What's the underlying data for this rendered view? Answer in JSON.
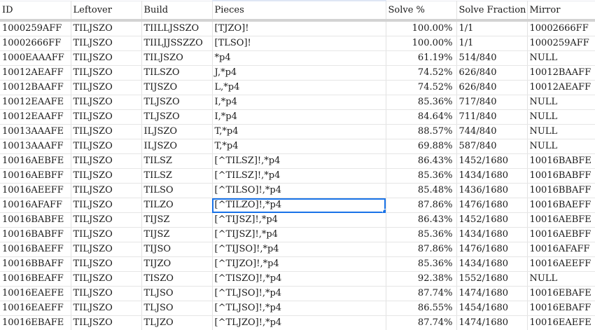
{
  "columns": [
    "ID",
    "Leftover",
    "Build",
    "Pieces",
    "Solve %",
    "Solve Fraction",
    "Mirror"
  ],
  "rows": [
    [
      "1000259AFF",
      "TILJSZO",
      "TIILLJSSZO",
      "[TJZO]!",
      "100.00%",
      "1/1",
      "10002666FF"
    ],
    [
      "10002666FF",
      "TILJSZO",
      "TIILJJSSZZO",
      "[TLSO]!",
      "100.00%",
      "1/1",
      "1000259AFF"
    ],
    [
      "1000EAAAFF",
      "TILJSZO",
      "TILJSZO",
      "*p4",
      "61.19%",
      "514/840",
      "NULL"
    ],
    [
      "10012AEAFF",
      "TILJSZO",
      "TILSZO",
      "J,*p4",
      "74.52%",
      "626/840",
      "10012BAAFF"
    ],
    [
      "10012BAAFF",
      "TILJSZO",
      "TIJSZO",
      "L,*p4",
      "74.52%",
      "626/840",
      "10012AEAFF"
    ],
    [
      "10012EAAFE",
      "TILJSZO",
      "TLJSZO",
      "I,*p4",
      "85.36%",
      "717/840",
      "NULL"
    ],
    [
      "10012EAAFF",
      "TILJSZO",
      "TLJSZO",
      "I,*p4",
      "84.64%",
      "711/840",
      "NULL"
    ],
    [
      "10013AAAFE",
      "TILJSZO",
      "ILJSZO",
      "T,*p4",
      "88.57%",
      "744/840",
      "NULL"
    ],
    [
      "10013AAAFF",
      "TILJSZO",
      "ILJSZO",
      "T,*p4",
      "69.88%",
      "587/840",
      "NULL"
    ],
    [
      "10016AEBFE",
      "TILJSZO",
      "TILSZ",
      "[^TILSZ]!,*p4",
      "86.43%",
      "1452/1680",
      "10016BABFE"
    ],
    [
      "10016AEBFF",
      "TILJSZO",
      "TILSZ",
      "[^TILSZ]!,*p4",
      "85.36%",
      "1434/1680",
      "10016BABFF"
    ],
    [
      "10016AEEFF",
      "TILJSZO",
      "TILSO",
      "[^TILSO]!,*p4",
      "85.48%",
      "1436/1680",
      "10016BBAFF"
    ],
    [
      "10016AFAFF",
      "TILJSZO",
      "TILZO",
      "[^TILZO]!,*p4",
      "87.86%",
      "1476/1680",
      "10016BAEFF"
    ],
    [
      "10016BABFE",
      "TILJSZO",
      "TIJSZ",
      "[^TIJSZ]!,*p4",
      "86.43%",
      "1452/1680",
      "10016AEBFE"
    ],
    [
      "10016BABFF",
      "TILJSZO",
      "TIJSZ",
      "[^TIJSZ]!,*p4",
      "85.36%",
      "1434/1680",
      "10016AEBFF"
    ],
    [
      "10016BAEFF",
      "TILJSZO",
      "TIJSO",
      "[^TIJSO]!,*p4",
      "87.86%",
      "1476/1680",
      "10016AFAFF"
    ],
    [
      "10016BBAFF",
      "TILJSZO",
      "TIJZO",
      "[^TIJZO]!,*p4",
      "85.36%",
      "1434/1680",
      "10016AEEFF"
    ],
    [
      "10016BEAFF",
      "TILJSZO",
      "TISZO",
      "[^TISZO]!,*p4",
      "92.38%",
      "1552/1680",
      "NULL"
    ],
    [
      "10016EAEFE",
      "TILJSZO",
      "TLJSO",
      "[^TLJSO]!,*p4",
      "87.74%",
      "1474/1680",
      "10016EBAFE"
    ],
    [
      "10016EAEFF",
      "TILJSZO",
      "TLJSO",
      "[^TLJSO]!,*p4",
      "86.55%",
      "1454/1680",
      "10016EBAFF"
    ],
    [
      "10016EBAFE",
      "TILJSZO",
      "TLJZO",
      "[^TLJZO]!,*p4",
      "87.74%",
      "1474/1680",
      "10016EAEFE"
    ]
  ],
  "selection": {
    "row": 12,
    "col": 3
  },
  "colors": {
    "selection_border": "#1a73e8",
    "grid_line": "#e2e2e2",
    "header_rule": "#d3d3d3"
  }
}
